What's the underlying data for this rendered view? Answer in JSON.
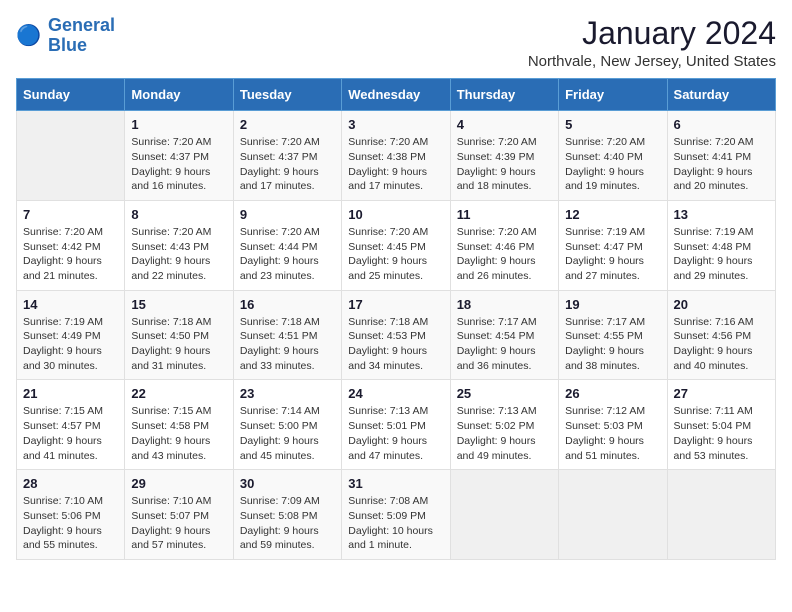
{
  "logo": {
    "line1": "General",
    "line2": "Blue"
  },
  "title": "January 2024",
  "location": "Northvale, New Jersey, United States",
  "weekdays": [
    "Sunday",
    "Monday",
    "Tuesday",
    "Wednesday",
    "Thursday",
    "Friday",
    "Saturday"
  ],
  "weeks": [
    [
      {
        "day": "",
        "info": ""
      },
      {
        "day": "1",
        "info": "Sunrise: 7:20 AM\nSunset: 4:37 PM\nDaylight: 9 hours\nand 16 minutes."
      },
      {
        "day": "2",
        "info": "Sunrise: 7:20 AM\nSunset: 4:37 PM\nDaylight: 9 hours\nand 17 minutes."
      },
      {
        "day": "3",
        "info": "Sunrise: 7:20 AM\nSunset: 4:38 PM\nDaylight: 9 hours\nand 17 minutes."
      },
      {
        "day": "4",
        "info": "Sunrise: 7:20 AM\nSunset: 4:39 PM\nDaylight: 9 hours\nand 18 minutes."
      },
      {
        "day": "5",
        "info": "Sunrise: 7:20 AM\nSunset: 4:40 PM\nDaylight: 9 hours\nand 19 minutes."
      },
      {
        "day": "6",
        "info": "Sunrise: 7:20 AM\nSunset: 4:41 PM\nDaylight: 9 hours\nand 20 minutes."
      }
    ],
    [
      {
        "day": "7",
        "info": "Sunrise: 7:20 AM\nSunset: 4:42 PM\nDaylight: 9 hours\nand 21 minutes."
      },
      {
        "day": "8",
        "info": "Sunrise: 7:20 AM\nSunset: 4:43 PM\nDaylight: 9 hours\nand 22 minutes."
      },
      {
        "day": "9",
        "info": "Sunrise: 7:20 AM\nSunset: 4:44 PM\nDaylight: 9 hours\nand 23 minutes."
      },
      {
        "day": "10",
        "info": "Sunrise: 7:20 AM\nSunset: 4:45 PM\nDaylight: 9 hours\nand 25 minutes."
      },
      {
        "day": "11",
        "info": "Sunrise: 7:20 AM\nSunset: 4:46 PM\nDaylight: 9 hours\nand 26 minutes."
      },
      {
        "day": "12",
        "info": "Sunrise: 7:19 AM\nSunset: 4:47 PM\nDaylight: 9 hours\nand 27 minutes."
      },
      {
        "day": "13",
        "info": "Sunrise: 7:19 AM\nSunset: 4:48 PM\nDaylight: 9 hours\nand 29 minutes."
      }
    ],
    [
      {
        "day": "14",
        "info": "Sunrise: 7:19 AM\nSunset: 4:49 PM\nDaylight: 9 hours\nand 30 minutes."
      },
      {
        "day": "15",
        "info": "Sunrise: 7:18 AM\nSunset: 4:50 PM\nDaylight: 9 hours\nand 31 minutes."
      },
      {
        "day": "16",
        "info": "Sunrise: 7:18 AM\nSunset: 4:51 PM\nDaylight: 9 hours\nand 33 minutes."
      },
      {
        "day": "17",
        "info": "Sunrise: 7:18 AM\nSunset: 4:53 PM\nDaylight: 9 hours\nand 34 minutes."
      },
      {
        "day": "18",
        "info": "Sunrise: 7:17 AM\nSunset: 4:54 PM\nDaylight: 9 hours\nand 36 minutes."
      },
      {
        "day": "19",
        "info": "Sunrise: 7:17 AM\nSunset: 4:55 PM\nDaylight: 9 hours\nand 38 minutes."
      },
      {
        "day": "20",
        "info": "Sunrise: 7:16 AM\nSunset: 4:56 PM\nDaylight: 9 hours\nand 40 minutes."
      }
    ],
    [
      {
        "day": "21",
        "info": "Sunrise: 7:15 AM\nSunset: 4:57 PM\nDaylight: 9 hours\nand 41 minutes."
      },
      {
        "day": "22",
        "info": "Sunrise: 7:15 AM\nSunset: 4:58 PM\nDaylight: 9 hours\nand 43 minutes."
      },
      {
        "day": "23",
        "info": "Sunrise: 7:14 AM\nSunset: 5:00 PM\nDaylight: 9 hours\nand 45 minutes."
      },
      {
        "day": "24",
        "info": "Sunrise: 7:13 AM\nSunset: 5:01 PM\nDaylight: 9 hours\nand 47 minutes."
      },
      {
        "day": "25",
        "info": "Sunrise: 7:13 AM\nSunset: 5:02 PM\nDaylight: 9 hours\nand 49 minutes."
      },
      {
        "day": "26",
        "info": "Sunrise: 7:12 AM\nSunset: 5:03 PM\nDaylight: 9 hours\nand 51 minutes."
      },
      {
        "day": "27",
        "info": "Sunrise: 7:11 AM\nSunset: 5:04 PM\nDaylight: 9 hours\nand 53 minutes."
      }
    ],
    [
      {
        "day": "28",
        "info": "Sunrise: 7:10 AM\nSunset: 5:06 PM\nDaylight: 9 hours\nand 55 minutes."
      },
      {
        "day": "29",
        "info": "Sunrise: 7:10 AM\nSunset: 5:07 PM\nDaylight: 9 hours\nand 57 minutes."
      },
      {
        "day": "30",
        "info": "Sunrise: 7:09 AM\nSunset: 5:08 PM\nDaylight: 9 hours\nand 59 minutes."
      },
      {
        "day": "31",
        "info": "Sunrise: 7:08 AM\nSunset: 5:09 PM\nDaylight: 10 hours\nand 1 minute."
      },
      {
        "day": "",
        "info": ""
      },
      {
        "day": "",
        "info": ""
      },
      {
        "day": "",
        "info": ""
      }
    ]
  ]
}
